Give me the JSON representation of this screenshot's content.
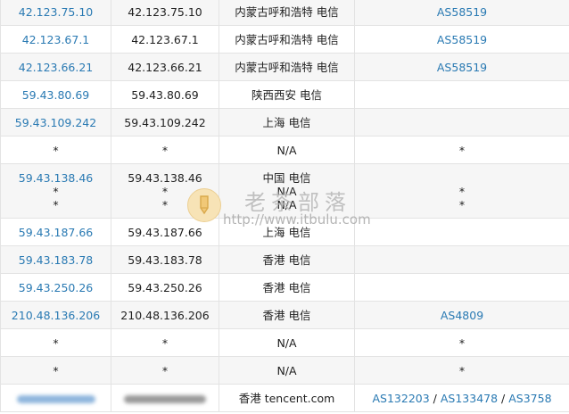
{
  "rows": [
    {
      "ip": "42.123.75.10",
      "host": "42.123.75.10",
      "location": "内蒙古呼和浩特 电信",
      "asn": "AS58519"
    },
    {
      "ip": "42.123.67.1",
      "host": "42.123.67.1",
      "location": "内蒙古呼和浩特 电信",
      "asn": "AS58519"
    },
    {
      "ip": "42.123.66.21",
      "host": "42.123.66.21",
      "location": "内蒙古呼和浩特 电信",
      "asn": "AS58519"
    },
    {
      "ip": "59.43.80.69",
      "host": "59.43.80.69",
      "location": "陕西西安 电信",
      "asn": ""
    },
    {
      "ip": "59.43.109.242",
      "host": "59.43.109.242",
      "location": "上海 电信",
      "asn": ""
    },
    {
      "ip": "*",
      "host": "*",
      "location": "N/A",
      "asn": "*"
    },
    {
      "multi": true,
      "ip_lines": [
        "59.43.138.46",
        "*",
        "*"
      ],
      "host_lines": [
        "59.43.138.46",
        "*",
        "*"
      ],
      "location_lines": [
        "中国 电信",
        "N/A",
        "N/A"
      ],
      "asn_lines": [
        "",
        "*",
        "*"
      ]
    },
    {
      "ip": "59.43.187.66",
      "host": "59.43.187.66",
      "location": "上海 电信",
      "asn": ""
    },
    {
      "ip": "59.43.183.78",
      "host": "59.43.183.78",
      "location": "香港 电信",
      "asn": ""
    },
    {
      "ip": "59.43.250.26",
      "host": "59.43.250.26",
      "location": "香港 电信",
      "asn": ""
    },
    {
      "ip": "210.48.136.206",
      "host": "210.48.136.206",
      "location": "香港 电信",
      "asn": "AS4809"
    },
    {
      "ip": "*",
      "host": "*",
      "location": "N/A",
      "asn": "*"
    },
    {
      "ip": "*",
      "host": "*",
      "location": "N/A",
      "asn": "*"
    },
    {
      "blurred": true,
      "location": "香港 tencent.com",
      "asns": [
        "AS132203",
        "AS133478",
        "AS3758"
      ],
      "asn_sep": " / "
    }
  ],
  "watermark": {
    "title": "老茶部落",
    "url": "http://www.itbulu.com",
    "icon": "pencil-badge-icon"
  }
}
